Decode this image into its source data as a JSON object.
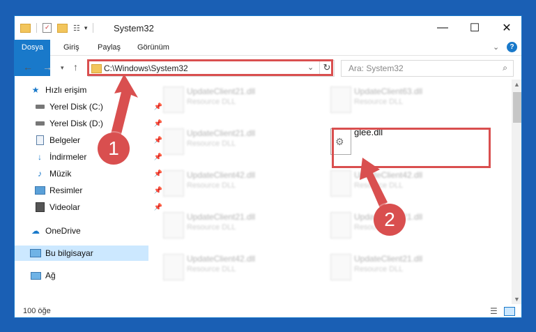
{
  "window": {
    "title": "System32",
    "controls": {
      "minimize": "—",
      "maximize": "☐",
      "close": "✕"
    }
  },
  "ribbon": {
    "tabs": [
      "Dosya",
      "Giriş",
      "Paylaş",
      "Görünüm"
    ],
    "collapse_icon": "chevron-down-icon",
    "help_icon": "help-icon"
  },
  "address": {
    "path": "C:\\Windows\\System32",
    "refresh_icon": "refresh-icon",
    "search_placeholder": "Ara: System32"
  },
  "nav": {
    "items": [
      {
        "label": "Hızlı erişim",
        "icon": "star-icon",
        "pinned": false
      },
      {
        "label": "Yerel Disk (C:)",
        "icon": "drive-icon",
        "pinned": true
      },
      {
        "label": "Yerel Disk (D:)",
        "icon": "drive-icon",
        "pinned": true
      },
      {
        "label": "Belgeler",
        "icon": "documents-icon",
        "pinned": true
      },
      {
        "label": "İndirmeler",
        "icon": "download-icon",
        "pinned": true
      },
      {
        "label": "Müzik",
        "icon": "music-icon",
        "pinned": true
      },
      {
        "label": "Resimler",
        "icon": "pictures-icon",
        "pinned": true
      },
      {
        "label": "Videolar",
        "icon": "video-icon",
        "pinned": true
      },
      {
        "label": "OneDrive",
        "icon": "cloud-icon",
        "pinned": false
      },
      {
        "label": "Bu bilgisayar",
        "icon": "computer-icon",
        "pinned": false,
        "selected": true
      },
      {
        "label": "Ağ",
        "icon": "network-icon",
        "pinned": false
      }
    ]
  },
  "files": [
    {
      "name": "UpdateClient21.dll",
      "type": "Resource DLL"
    },
    {
      "name": "UpdateClient63.dll",
      "type": "Resource DLL"
    },
    {
      "name": "UpdateClient21.dll",
      "type": "Resource DLL"
    },
    {
      "name": "glee.dll",
      "type": ""
    },
    {
      "name": "UpdateClient42.dll",
      "type": "Resource DLL"
    },
    {
      "name": "UpdateClient42.dll",
      "type": "Resource DLL"
    },
    {
      "name": "UpdateClient21.dll",
      "type": "Resource DLL"
    },
    {
      "name": "UpdateClient21.dll",
      "type": "Resource DLL"
    },
    {
      "name": "UpdateClient42.dll",
      "type": "Resource DLL"
    },
    {
      "name": "UpdateClient21.dll",
      "type": "Resource DLL"
    }
  ],
  "annotations": {
    "step1": "1",
    "step2": "2",
    "color": "#d94f4f"
  },
  "status": {
    "count": "100 öğe"
  }
}
